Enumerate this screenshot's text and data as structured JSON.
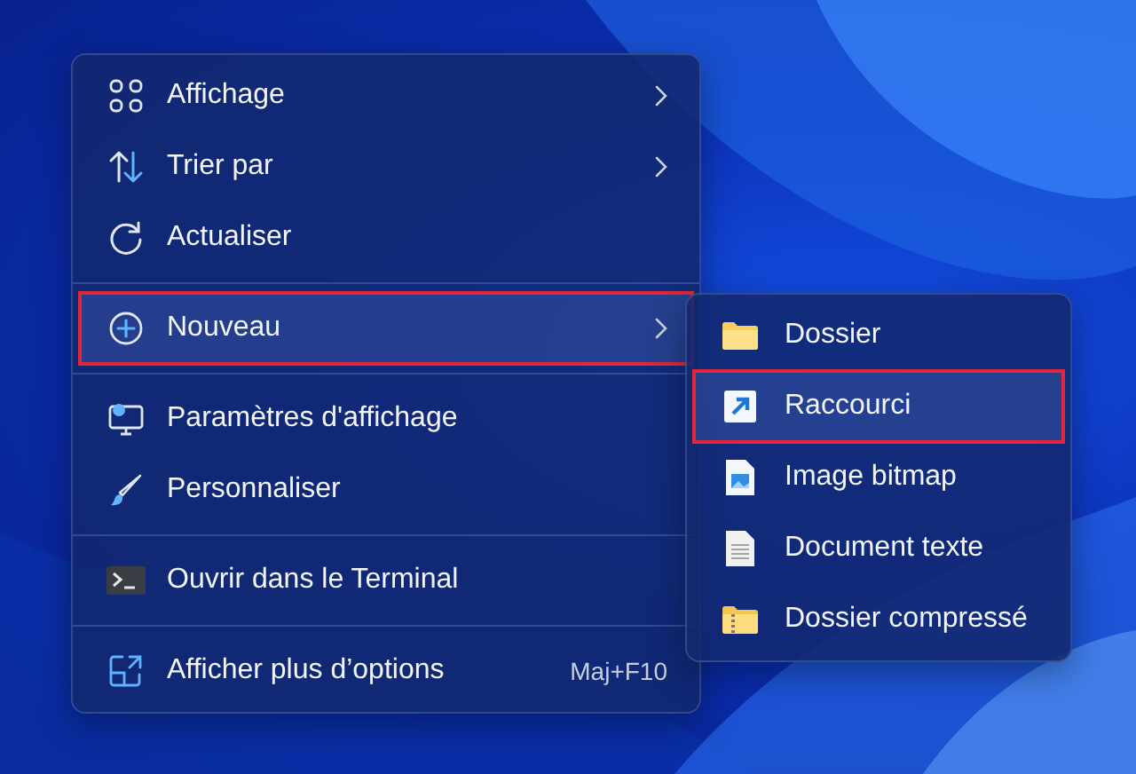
{
  "context_menu": {
    "groups": [
      {
        "items": [
          {
            "label": "Affichage",
            "has_submenu": true,
            "highlighted": false
          },
          {
            "label": "Trier par",
            "has_submenu": true,
            "highlighted": false
          },
          {
            "label": "Actualiser",
            "has_submenu": false,
            "highlighted": false
          }
        ]
      },
      {
        "items": [
          {
            "label": "Nouveau",
            "has_submenu": true,
            "highlighted": true
          }
        ]
      },
      {
        "items": [
          {
            "label": "Paramètres d'affichage",
            "has_submenu": false,
            "highlighted": false
          },
          {
            "label": "Personnaliser",
            "has_submenu": false,
            "highlighted": false
          }
        ]
      },
      {
        "items": [
          {
            "label": "Ouvrir dans le Terminal",
            "has_submenu": false,
            "highlighted": false
          }
        ]
      },
      {
        "items": [
          {
            "label": "Afficher plus d’options",
            "has_submenu": false,
            "highlighted": false,
            "shortcut": "Maj+F10"
          }
        ]
      }
    ]
  },
  "submenu": {
    "items": [
      {
        "label": "Dossier",
        "highlighted": false
      },
      {
        "label": "Raccourci",
        "highlighted": true
      },
      {
        "label": "Image bitmap",
        "highlighted": false
      },
      {
        "label": "Document texte",
        "highlighted": false
      },
      {
        "label": "Dossier compressé",
        "highlighted": false
      }
    ]
  }
}
